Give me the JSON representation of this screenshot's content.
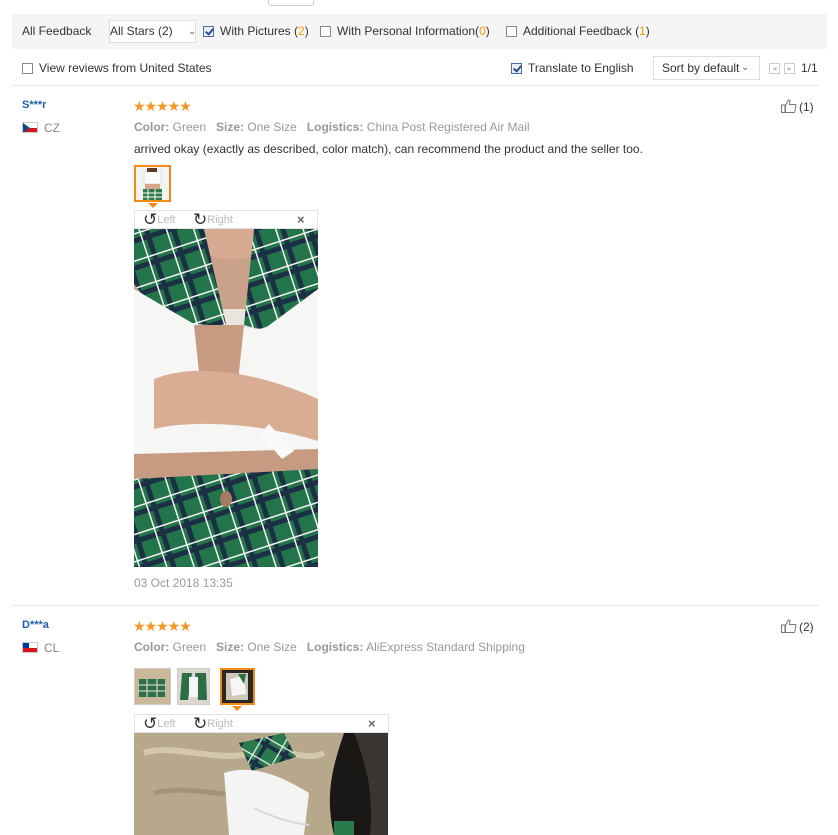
{
  "filters": {
    "all_feedback": "All Feedback",
    "all_stars": "All Stars (2)",
    "with_pictures": {
      "label": "With Pictures (",
      "count": "2",
      "close": ")",
      "checked": true
    },
    "personal_info": {
      "label": "With Personal Information(",
      "count": "0",
      "close": ")",
      "checked": false
    },
    "additional": {
      "label": "Additional Feedback (",
      "count": "1",
      "close": ")",
      "checked": false
    }
  },
  "options": {
    "view_us": "View reviews from United States",
    "translate": "Translate to English",
    "sort": "Sort by default",
    "page": "1/1"
  },
  "reviews": [
    {
      "user": "S***r",
      "country": "CZ",
      "stars": "★★★★★",
      "color_label": "Color:",
      "color": "Green",
      "size_label": "Size:",
      "size": "One Size",
      "logistics_label": "Logistics:",
      "logistics": "China Post Registered Air Mail",
      "comment": "arrived okay (exactly as described, color match), can recommend the product and the seller too.",
      "likes": "(1)",
      "viewer_left": "Left",
      "viewer_right": "Right",
      "date": "03 Oct 2018 13:35"
    },
    {
      "user": "D***a",
      "country": "CL",
      "stars": "★★★★★",
      "color_label": "Color:",
      "color": "Green",
      "size_label": "Size:",
      "size": "One Size",
      "logistics_label": "Logistics:",
      "logistics": "AliExpress Standard Shipping",
      "likes": "(2)",
      "viewer_left": "Left",
      "viewer_right": "Right"
    }
  ],
  "icons": {
    "close": "×",
    "rotate_left": "↺",
    "rotate_right": "↻",
    "sort_caret": "⌄"
  },
  "colors": {
    "username": "#1f5eaa",
    "stars": "#f7931e",
    "count_highlight": "#ff9900",
    "selected_border": "#f28a1a"
  }
}
